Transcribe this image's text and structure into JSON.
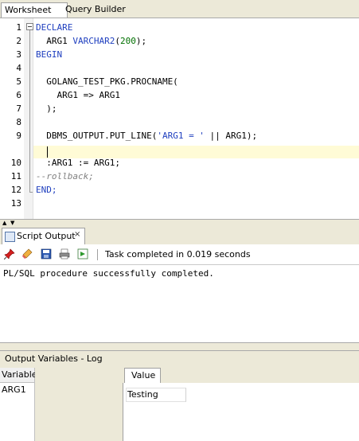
{
  "top_tabs": {
    "worksheet": "Worksheet",
    "query_builder": "Query Builder"
  },
  "editor": {
    "line_numbers": [
      "1",
      "2",
      "3",
      "4",
      "5",
      "6",
      "7",
      "8",
      "9",
      "10",
      "11",
      "12",
      "13"
    ],
    "lines": {
      "l1": "DECLARE",
      "l2_name": "  ARG1 ",
      "l2_type": "VARCHAR2",
      "l2_open": "(",
      "l2_num": "200",
      "l2_close": ");",
      "l3": "BEGIN",
      "l5": "  GOLANG_TEST_PKG.PROCNAME(",
      "l6": "    ARG1 => ARG1",
      "l7": "  );",
      "l9_pre": "  DBMS_OUTPUT.PUT_LINE(",
      "l9_str": "'ARG1 = '",
      "l9_post": " || ARG1);",
      "l11": "  :ARG1 := ARG1;",
      "l12": "--rollback;",
      "l13": "END;"
    },
    "colors": {
      "keyword": "#1f3fbf",
      "number": "#007000",
      "comment": "#808080",
      "current_line": "#fffbd6"
    }
  },
  "script_output": {
    "tab_label": "Script Output",
    "close_glyph": "×",
    "status": "Task completed in 0.019 seconds",
    "toolbar_icons": [
      "pin-icon",
      "eraser-icon",
      "save-icon",
      "print-icon",
      "open-file-icon"
    ],
    "content": "PL/SQL procedure successfully completed."
  },
  "output_variables": {
    "title": "Output Variables - Log",
    "variable_header": "Variable",
    "variables": [
      "ARG1"
    ],
    "value_tab": "Value",
    "value": "Testing"
  }
}
